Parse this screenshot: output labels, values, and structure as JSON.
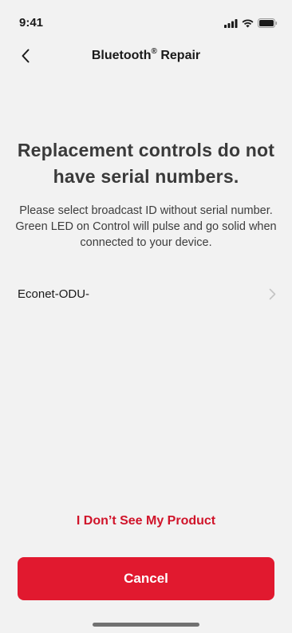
{
  "status_bar": {
    "time": "9:41",
    "icons": [
      "signal-icon",
      "wifi-icon",
      "battery-icon"
    ]
  },
  "nav": {
    "back_icon": "chevron-left-icon",
    "title": "Bluetooth",
    "title_mark": "®",
    "title_suffix": " Repair"
  },
  "headline": "Replacement controls do not have serial numbers.",
  "description": "Please select broadcast ID without serial number. Green LED on Control will pulse and go solid when connected to your device.",
  "devices": [
    {
      "name": "Econet-ODU-",
      "icon": "chevron-right-icon"
    }
  ],
  "link_label": "I Don’t See My Product",
  "cancel_label": "Cancel",
  "colors": {
    "brand_red": "#e1192f",
    "link_red": "#d0142a",
    "background": "#f2f2f2"
  }
}
